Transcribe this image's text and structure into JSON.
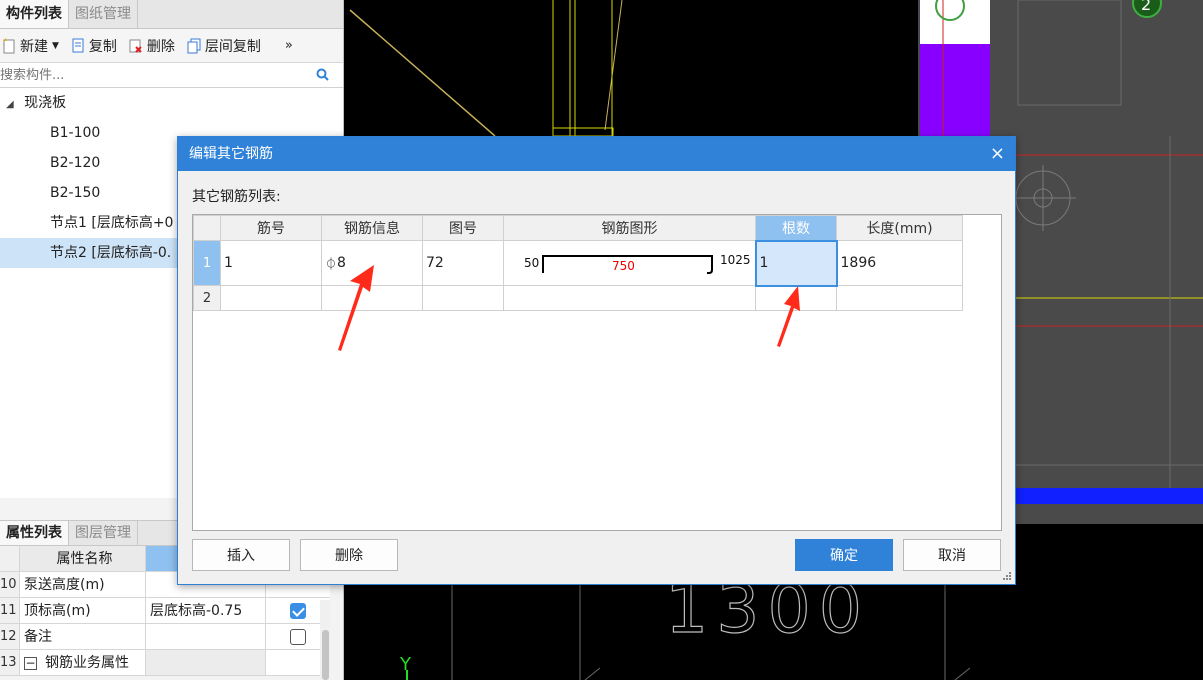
{
  "left_panel": {
    "tabs": [
      "构件列表",
      "图纸管理"
    ],
    "toolbar": {
      "new_label": "新建",
      "copy_label": "复制",
      "delete_label": "删除",
      "floor_copy_label": "层间复制",
      "more": "»"
    },
    "search_placeholder": "搜索构件...",
    "tree": {
      "group_label": "现浇板",
      "items": [
        "B1-100",
        "B2-120",
        "B2-150",
        "节点1 [层底标高+0",
        "节点2 [层底标高-0."
      ],
      "selected_index": 4
    }
  },
  "props_panel": {
    "tabs": [
      "属性列表",
      "图层管理"
    ],
    "header_name": "属性名称",
    "rows": [
      {
        "num": "10",
        "name": "泵送高度(m)",
        "value": "",
        "checked": null
      },
      {
        "num": "11",
        "name": "顶标高(m)",
        "value": "层底标高-0.75",
        "checked": true
      },
      {
        "num": "12",
        "name": "备注",
        "value": "",
        "checked": false
      },
      {
        "num": "13",
        "name": "钢筋业务属性",
        "value": "",
        "checked": null
      }
    ],
    "expand_glyph": "−"
  },
  "dialog": {
    "title": "编辑其它钢筋",
    "close_glyph": "×",
    "list_label": "其它钢筋列表:",
    "columns": [
      "筋号",
      "钢筋信息",
      "图号",
      "钢筋图形",
      "根数",
      "长度(mm)"
    ],
    "highlighted_column": "根数",
    "rows": [
      {
        "row_no": "1",
        "bar_no": "1",
        "bar_info": "8",
        "bar_symbol": "⏀",
        "fig_no": "72",
        "shape": {
          "left": "50",
          "middle": "750",
          "right": "1025"
        },
        "count": "1",
        "length": "1896"
      },
      {
        "row_no": "2",
        "bar_no": "",
        "bar_info": "",
        "bar_symbol": "",
        "fig_no": "",
        "shape": null,
        "count": "",
        "length": ""
      }
    ],
    "buttons": {
      "insert": "插入",
      "delete": "删除",
      "ok": "确定",
      "cancel": "取消"
    }
  },
  "cad_canvas": {
    "visible_text": "1300",
    "axis_label": "Y",
    "marker_label": "2"
  },
  "colors": {
    "accent": "#2f82d8",
    "header_highlight": "#8ec0f0",
    "arrow": "#ff2a1a",
    "shape_dim_text": "#ee0000"
  }
}
